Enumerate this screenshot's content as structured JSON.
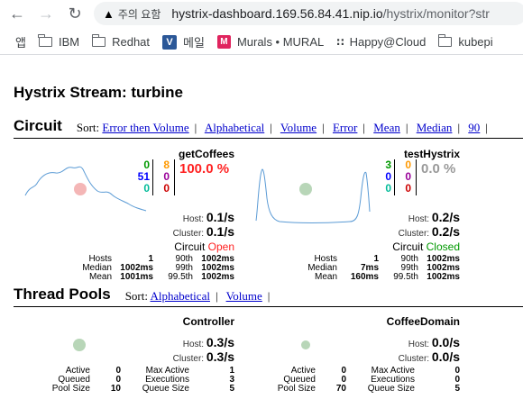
{
  "browser": {
    "security_label": "주의 요함",
    "url_host": "hystrix-dashboard.169.56.84.41.nip.io",
    "url_path": "/hystrix/monitor?str",
    "bookmarks": [
      {
        "label": "앱",
        "icon": "apps-icon"
      },
      {
        "label": "IBM",
        "icon": "folder-icon"
      },
      {
        "label": "Redhat",
        "icon": "folder-icon"
      },
      {
        "label": "메일",
        "icon": "v-logo-icon"
      },
      {
        "label": "Murals • MURAL",
        "icon": "mural-icon"
      },
      {
        "label": "Happy@Cloud",
        "icon": "dots-icon"
      },
      {
        "label": "kubepi",
        "icon": "folder-icon"
      }
    ]
  },
  "page_title": "Hystrix Stream: turbine",
  "circuit_section": {
    "heading": "Circuit",
    "sort_label": "Sort:",
    "sort_links": [
      "Error then Volume",
      "Alphabetical",
      "Volume",
      "Error",
      "Mean",
      "Median",
      "90"
    ]
  },
  "circuits": [
    {
      "name": "getCoffees",
      "counts_green": [
        "0",
        "51",
        "0"
      ],
      "counts_colors": [
        "#090",
        "#00f",
        "#0b9"
      ],
      "counts_right": [
        "8",
        "0",
        "0"
      ],
      "counts_right_colors": [
        "#f90",
        "#909",
        "#c00"
      ],
      "percent": "100.0 %",
      "percent_color": "#f22",
      "host_label": "Host:",
      "host_rate": "0.1/s",
      "cluster_label": "Cluster:",
      "cluster_rate": "0.1/s",
      "circuit_label": "Circuit",
      "circuit_state": "Open",
      "state_color": "#f22",
      "dot_color": "#f4b6b6",
      "stats_left": [
        [
          "Hosts",
          "1"
        ],
        [
          "Median",
          "1002ms"
        ],
        [
          "Mean",
          "1001ms"
        ]
      ],
      "stats_right": [
        [
          "90th",
          "1002ms"
        ],
        [
          "99th",
          "1002ms"
        ],
        [
          "99.5th",
          "1002ms"
        ]
      ]
    },
    {
      "name": "testHystrix",
      "counts_green": [
        "3",
        "0",
        "0"
      ],
      "counts_colors": [
        "#090",
        "#00f",
        "#0b9"
      ],
      "counts_right": [
        "0",
        "0",
        "0"
      ],
      "counts_right_colors": [
        "#f90",
        "#909",
        "#c00"
      ],
      "percent": "0.0 %",
      "percent_color": "#999",
      "host_label": "Host:",
      "host_rate": "0.2/s",
      "cluster_label": "Cluster:",
      "cluster_rate": "0.2/s",
      "circuit_label": "Circuit",
      "circuit_state": "Closed",
      "state_color": "#090",
      "dot_color": "#b8d6b8",
      "stats_left": [
        [
          "Hosts",
          "1"
        ],
        [
          "Median",
          "7ms"
        ],
        [
          "Mean",
          "160ms"
        ]
      ],
      "stats_right": [
        [
          "90th",
          "1002ms"
        ],
        [
          "99th",
          "1002ms"
        ],
        [
          "99.5th",
          "1002ms"
        ]
      ]
    }
  ],
  "pool_section": {
    "heading": "Thread Pools",
    "sort_label": "Sort:",
    "sort_links": [
      "Alphabetical",
      "Volume"
    ]
  },
  "pools": [
    {
      "name": "Controller",
      "host_label": "Host:",
      "host_rate": "0.3/s",
      "cluster_label": "Cluster:",
      "cluster_rate": "0.3/s",
      "stats_left": [
        [
          "Active",
          "0"
        ],
        [
          "Queued",
          "0"
        ],
        [
          "Pool Size",
          "10"
        ]
      ],
      "stats_right": [
        [
          "Max Active",
          "1"
        ],
        [
          "Executions",
          "3"
        ],
        [
          "Queue Size",
          "5"
        ]
      ]
    },
    {
      "name": "CoffeeDomain",
      "host_label": "Host:",
      "host_rate": "0.0/s",
      "cluster_label": "Cluster:",
      "cluster_rate": "0.0/s",
      "stats_left": [
        [
          "Active",
          "0"
        ],
        [
          "Queued",
          "0"
        ],
        [
          "Pool Size",
          "70"
        ]
      ],
      "stats_right": [
        [
          "Max Active",
          "0"
        ],
        [
          "Executions",
          "0"
        ],
        [
          "Queue Size",
          "5"
        ]
      ]
    }
  ]
}
